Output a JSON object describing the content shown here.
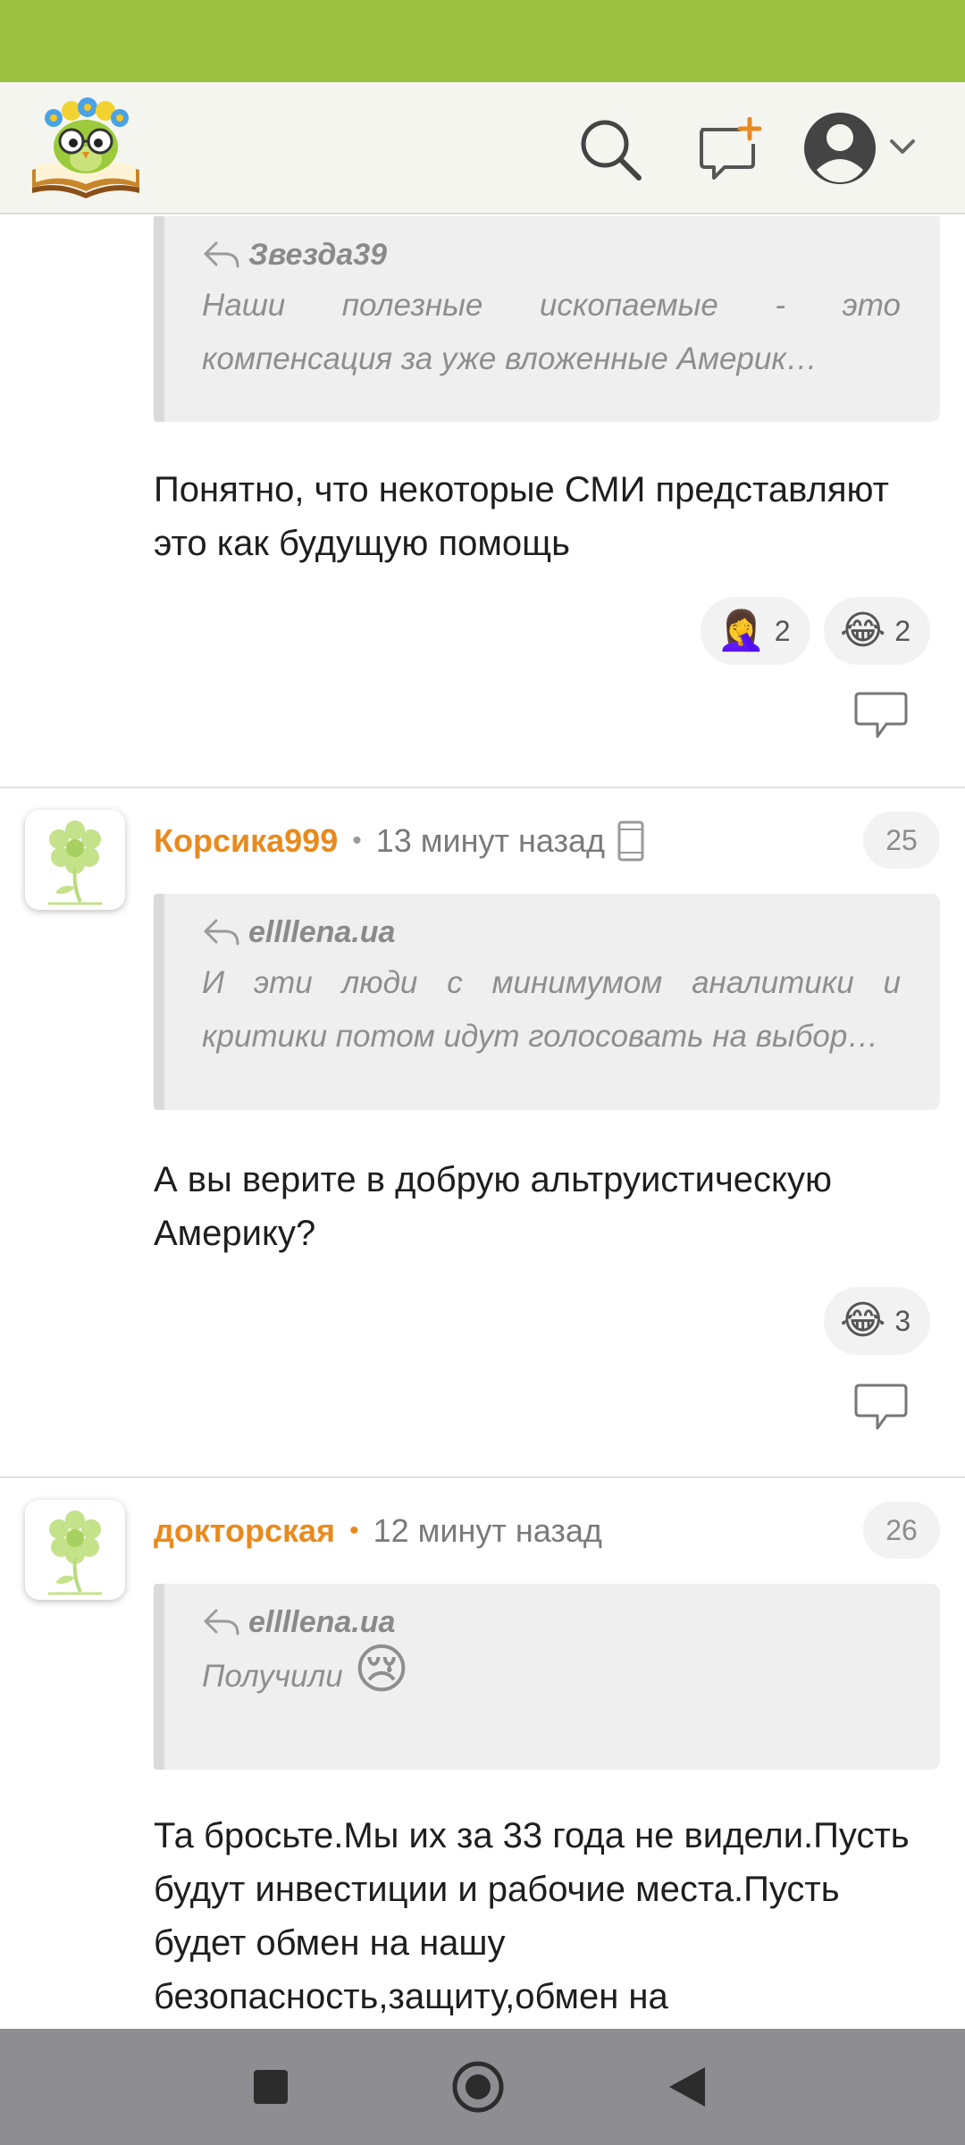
{
  "colors": {
    "status_bar": "#9dc243",
    "accent": "#e88a1e",
    "header_bg": "#f5f5f0",
    "nav_bar": "#8d8d92"
  },
  "header": {
    "logo_icon": "owl-book-logo-icon",
    "search_icon": "search-icon",
    "new_post_icon": "new-post-icon",
    "profile_icon": "user-avatar-icon",
    "dropdown_icon": "chevron-down-icon"
  },
  "comments": [
    {
      "quote_author": "Звезда39",
      "quote_lines": [
        "Наши полезные ископаемые - это",
        "компенсация за уже вложенные Америк…"
      ],
      "text": "Понятно, что некоторые СМИ представляют это как будущую помощь",
      "reactions": [
        {
          "emoji": "🤦‍♀️",
          "count": "2"
        },
        {
          "emoji": "😂",
          "count": "2"
        }
      ]
    },
    {
      "username": "Корсика999",
      "time": "13 минут назад",
      "number": "25",
      "device_icon": "mobile-phone-icon",
      "quote_author": "ellllena.ua",
      "quote_lines": [
        "И эти люди с минимумом аналитики и",
        "критики потом идут голосовать на выбор…"
      ],
      "text": "А вы верите в добрую альтруистическую Америку?",
      "reactions": [
        {
          "emoji": "😂",
          "count": "3"
        }
      ]
    },
    {
      "username": "докторская",
      "time": "12 минут назад",
      "number": "26",
      "quote_author": "ellllena.ua",
      "quote_lines": [
        "Получили"
      ],
      "quote_emoji": "😢",
      "text": "Та бросьте.Мы их за 33 года не видели.Пусть будут инвестиции и рабочие места.Пусть будет обмен на нашу безопасность,защиту,обмен на"
    }
  ],
  "navigation": {
    "recent_icon": "square-recent-apps-icon",
    "home_icon": "circle-home-icon",
    "back_icon": "triangle-back-icon"
  }
}
